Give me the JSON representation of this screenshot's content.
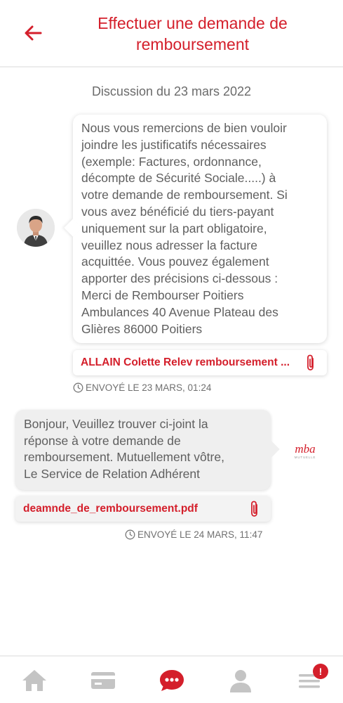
{
  "header": {
    "title_line1": "Effectuer une demande de",
    "title_line2": "remboursement",
    "back_icon": "arrow-left-icon"
  },
  "thread": {
    "date_label": "Discussion du 23 mars 2022",
    "messages": [
      {
        "direction": "incoming",
        "lines": [
          "Nous vous remercions de bien vouloir",
          "joindre les justificatifs nécessaires",
          "(exemple: Factures, ordonnance,",
          "décompte de Sécurité Sociale.....) à",
          "votre demande de remboursement. Si",
          "vous avez bénéficié du tiers-payant",
          "uniquement sur la part obligatoire,",
          "veuillez nous adresser la facture",
          "acquittée. Vous pouvez également",
          "apporter des précisions ci-dessous :",
          "Merci de Rembourser Poitiers",
          "Ambulances 40 Avenue Plateau des",
          "Glières 86000 Poitiers"
        ],
        "attachment": "ALLAIN Colette Relev remboursement ...",
        "sent": "ENVOYÉ LE 23 MARS, 01:24"
      },
      {
        "direction": "outgoing",
        "lines": [
          "Bonjour, Veuillez trouver ci-joint la",
          "réponse à votre demande de",
          "remboursement. Mutuellement vôtre,",
          "Le Service de Relation Adhérent"
        ],
        "attachment": "deamnde_de_remboursement.pdf",
        "sent": "ENVOYÉ LE 24 MARS, 11:47"
      }
    ],
    "logo": {
      "text": "mba",
      "subtext": "MUTUELLE"
    }
  },
  "tabbar": {
    "items": [
      "home-icon",
      "card-icon",
      "chat-icon",
      "profile-icon",
      "menu-icon"
    ],
    "active": "chat-icon",
    "badge": "!"
  },
  "colors": {
    "accent": "#d41f2b",
    "inactive_icon": "#c4c4c4"
  }
}
